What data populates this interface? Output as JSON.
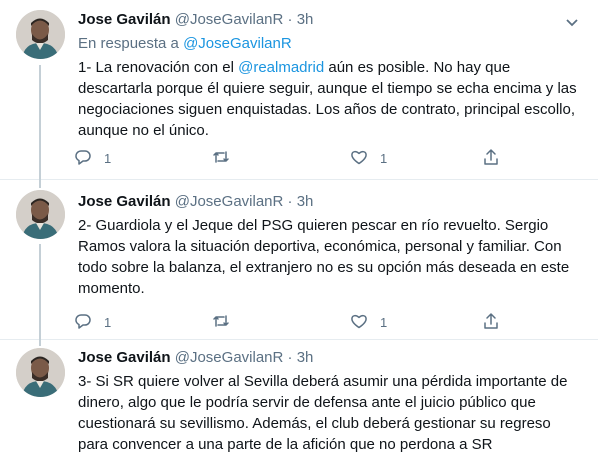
{
  "tweets": [
    {
      "name": "Jose Gavilán",
      "handle": "@JoseGavilanR",
      "dot": "·",
      "time": "3h",
      "reply_prefix": "En respuesta a",
      "reply_handle": "@JoseGavilanR",
      "text_pre": "1- La renovación con el ",
      "mention": "@realmadrid",
      "text_post": " aún es posible. No hay que descartarla porque él quiere seguir, aunque el tiempo se echa encima y las negociaciones siguen enquistadas. Los años de contrato, principal escollo, aunque no el único.",
      "replies": "1",
      "retweets": "",
      "likes": "1"
    },
    {
      "name": "Jose Gavilán",
      "handle": "@JoseGavilanR",
      "dot": "·",
      "time": "3h",
      "text": "2- Guardiola y el Jeque del PSG quieren pescar en río revuelto. Sergio Ramos valora la situación deportiva, económica, personal y familiar. Con todo sobre la balanza, el extranjero no es su opción más deseada en este momento.",
      "replies": "1",
      "retweets": "",
      "likes": "1"
    },
    {
      "name": "Jose Gavilán",
      "handle": "@JoseGavilanR",
      "dot": "·",
      "time": "3h",
      "text": "3- Si SR quiere volver al Sevilla deberá asumir una pérdida importante de dinero, algo que le podría servir de defensa ante el juicio público que cuestionará su sevillismo. Además, el club deberá gestionar su regreso para convencer a una parte de la afición que no perdona a SR"
    }
  ],
  "icons": {
    "reply": "reply-icon",
    "retweet": "retweet-icon",
    "like": "heart-icon",
    "share": "share-icon",
    "more": "chevron-down-icon"
  },
  "colors": {
    "link": "#1b95e0",
    "secondary_text": "#5b7083",
    "divider": "#e6ecf0"
  }
}
